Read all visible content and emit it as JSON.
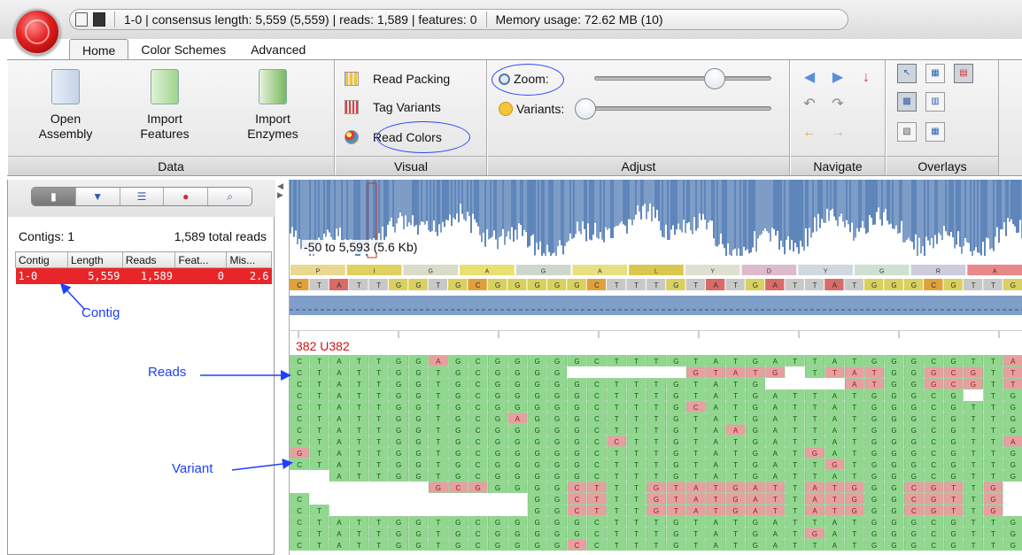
{
  "window": {
    "status_text": "1-0  |  consensus length: 5,559 (5,559)  |  reads: 1,589  |  features: 0",
    "memory_text": "Memory usage: 72.62 MB (10)"
  },
  "tabs": [
    {
      "label": "Home",
      "active": true
    },
    {
      "label": "Color Schemes",
      "active": false
    },
    {
      "label": "Advanced",
      "active": false
    }
  ],
  "ribbon": {
    "data_group": {
      "label": "Data",
      "buttons": [
        {
          "line1": "Open",
          "line2": "Assembly",
          "icon": "open-assembly-icon"
        },
        {
          "line1": "Import",
          "line2": "Features",
          "icon": "import-features-icon"
        },
        {
          "line1": "Import",
          "line2": "Enzymes",
          "icon": "import-enzymes-icon"
        }
      ]
    },
    "visual_group": {
      "label": "Visual",
      "items": [
        {
          "label": "Read Packing",
          "icon": "read-packing-icon"
        },
        {
          "label": "Tag Variants",
          "icon": "tag-variants-icon"
        },
        {
          "label": "Read Colors",
          "icon": "palette-icon"
        }
      ]
    },
    "adjust_group": {
      "label": "Adjust",
      "zoom_label": "Zoom:",
      "variants_label": "Variants:",
      "zoom_level": 0.68,
      "variants_level": 0.0
    },
    "navigate_group": {
      "label": "Navigate",
      "icons": [
        "page-left-icon",
        "page-right-icon",
        "next-variant-icon",
        "undo-icon",
        "redo-icon",
        "back-icon",
        "forward-icon"
      ]
    },
    "overlays_group": {
      "label": "Overlays",
      "icons": [
        "pointer-icon",
        "grid-icon",
        "read-icon",
        "bc-ct-icon",
        "column-icon",
        "export-icon",
        "table-icon"
      ]
    }
  },
  "left_panel": {
    "toolbar_icons": [
      "database-icon",
      "dropdown-icon",
      "list-icon",
      "color-balls-icon",
      "search-icon"
    ],
    "contigs_summary": "Contigs: 1",
    "total_reads": "1,589 total reads",
    "table": {
      "headers": [
        "Contig",
        "Length",
        "Reads",
        "Feat...",
        "Mis..."
      ],
      "rows": [
        {
          "contig": "1-0",
          "length": "5,559",
          "reads": "1,589",
          "features": "0",
          "mismatch": "2.6"
        }
      ]
    }
  },
  "view": {
    "range_label": "-50 to 5,593 (5.6 Kb)",
    "read_label": "382 U382",
    "translation": [
      "P",
      "I",
      "G",
      "A",
      "G",
      "A",
      "L",
      "Y",
      "D",
      "Y",
      "G",
      "R",
      "A"
    ],
    "consensus": "CTATTGGTGCGGGGGCTTTGTATGATTATGGGCGTTG",
    "reads": [
      "CTATTGGAGCGGGGGCTTTGTATGATTATGGGCGTTA",
      "CTATTGGTGCGGGG------GTATG-TTATGGGCGTTG",
      "CTATTGGTGCGGGGGCTTTGTATG----ATGGGCGTTG",
      "CTATTGGTGCGGGGGCTTTGTATGATTATGGGCG-TG",
      "CTATTGGTGCGGGGGCTTTGCATGATTATGGGCGTTG",
      "CTATTGGTGCGAGGGCTTTGTATGATTATGGGCGTTG",
      "CTATTGGTGCGGGGGCTTTGTAAGATTATGGGCGTTG",
      "CTATTGGTGCGGGGGCCTTGTATGATTATGGGCGTTA",
      "GTATTGGTGCGGGGGCTTTGTATGATGATGGGCGTTG",
      "CTATTGGTGCGGGGGCTTTGTATGATTGTGGGCGTTG",
      "--ATTGGTGCGGGGGCTTTGTATGATTATGGGCGTTG",
      "-------GCGGGGGCTTTGTATGATTATGGGCGTTG",
      "C-----------GGCTTTGTATGATTATGGGCGTTG",
      "CT----------GGCTTTGTATGATTATGGGCGTTG",
      "CTATTGGTGCGGGGGCTTTGTATGATTATGGGCGTTG",
      "CTATTGGTGCGGGGGCTTTGTATGATGATGGGCGTTG",
      "CTATTGGTGCGGGGCCTTTGTATGATTATGGGCGTTG"
    ]
  },
  "annotations": {
    "contig": "Contig",
    "reads": "Reads",
    "variant": "Variant"
  },
  "colors": {
    "selection_red": "#e8262a",
    "read_green": "#8fd88d",
    "variant_red": "#e6a0a0",
    "annotation_blue": "#1f3fff",
    "coverage_blue": "#5f86bb"
  }
}
